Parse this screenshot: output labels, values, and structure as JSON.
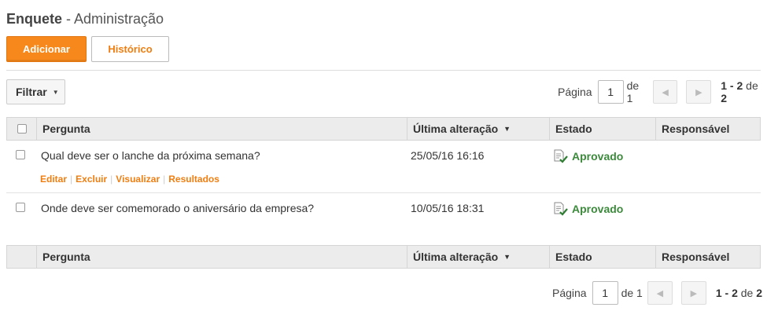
{
  "header": {
    "title_bold": "Enquete",
    "title_rest": " - Administração"
  },
  "toolbar": {
    "add_label": "Adicionar",
    "history_label": "Histórico"
  },
  "filter": {
    "label": "Filtrar"
  },
  "pager": {
    "page_label": "Página",
    "page_value": "1",
    "of_label": "de 1",
    "range": "1 - 2",
    "range_of": " de ",
    "total": "2"
  },
  "table": {
    "columns": [
      "Pergunta",
      "Última alteração",
      "Estado",
      "Responsável"
    ],
    "rows": [
      {
        "question": "Qual deve ser o lanche da próxima semana?",
        "date": "25/05/16 16:16",
        "status": "Aprovado",
        "responsible": ""
      },
      {
        "question": "Onde deve ser comemorado o aniversário da empresa?",
        "date": "10/05/16 18:31",
        "status": "Aprovado",
        "responsible": ""
      }
    ],
    "row_actions": [
      "Editar",
      "Excluir",
      "Visualizar",
      "Resultados"
    ]
  },
  "colors": {
    "accent": "#f7881b",
    "status_ok": "#3c8a3c"
  }
}
